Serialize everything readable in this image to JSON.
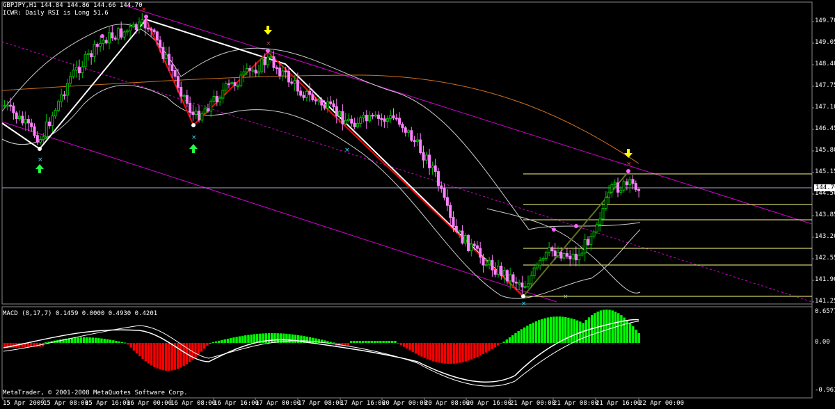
{
  "symbol_header": "GBPJPY,H1  144.84 144.86 144.66 144.70",
  "indicator_note": "ICWR: Daily RSI is Long 51.6",
  "macd_header": "MACD (8,17,7) 0.1459 0.0000 0.4930 0.4201",
  "copyright": "MetaTrader, © 2001-2008 MetaQuotes Software Corp.",
  "current_price": "144.70",
  "price_ticks": [
    "149.70",
    "149.05",
    "148.40",
    "147.75",
    "147.10",
    "146.45",
    "145.80",
    "145.15",
    "144.50",
    "143.85",
    "143.20",
    "142.55",
    "141.90",
    "141.25"
  ],
  "macd_ticks": [
    "0.6577",
    "0.00",
    "-0.9634"
  ],
  "time_ticks": [
    "15 Apr 2009",
    "15 Apr 08:00",
    "15 Apr 16:00",
    "16 Apr 00:00",
    "16 Apr 08:00",
    "16 Apr 16:00",
    "17 Apr 00:00",
    "17 Apr 08:00",
    "17 Apr 16:00",
    "20 Apr 00:00",
    "20 Apr 08:00",
    "20 Apr 16:00",
    "21 Apr 00:00",
    "21 Apr 08:00",
    "21 Apr 16:00",
    "22 Apr 00:00"
  ],
  "colors": {
    "bull": "#00c000",
    "bear": "#ff80ff",
    "macd_pos": "#00ff00",
    "macd_neg": "#ff0000",
    "channel": "#d000d0",
    "ma": "#d07020",
    "fib": "#ffff80",
    "zigzag_white": "#ffffff",
    "zigzag_red": "#ff0000"
  },
  "chart_data": {
    "type": "candlestick",
    "main_ylim": [
      141.25,
      149.7
    ],
    "macd_ylim": [
      -0.9634,
      0.6577
    ]
  }
}
